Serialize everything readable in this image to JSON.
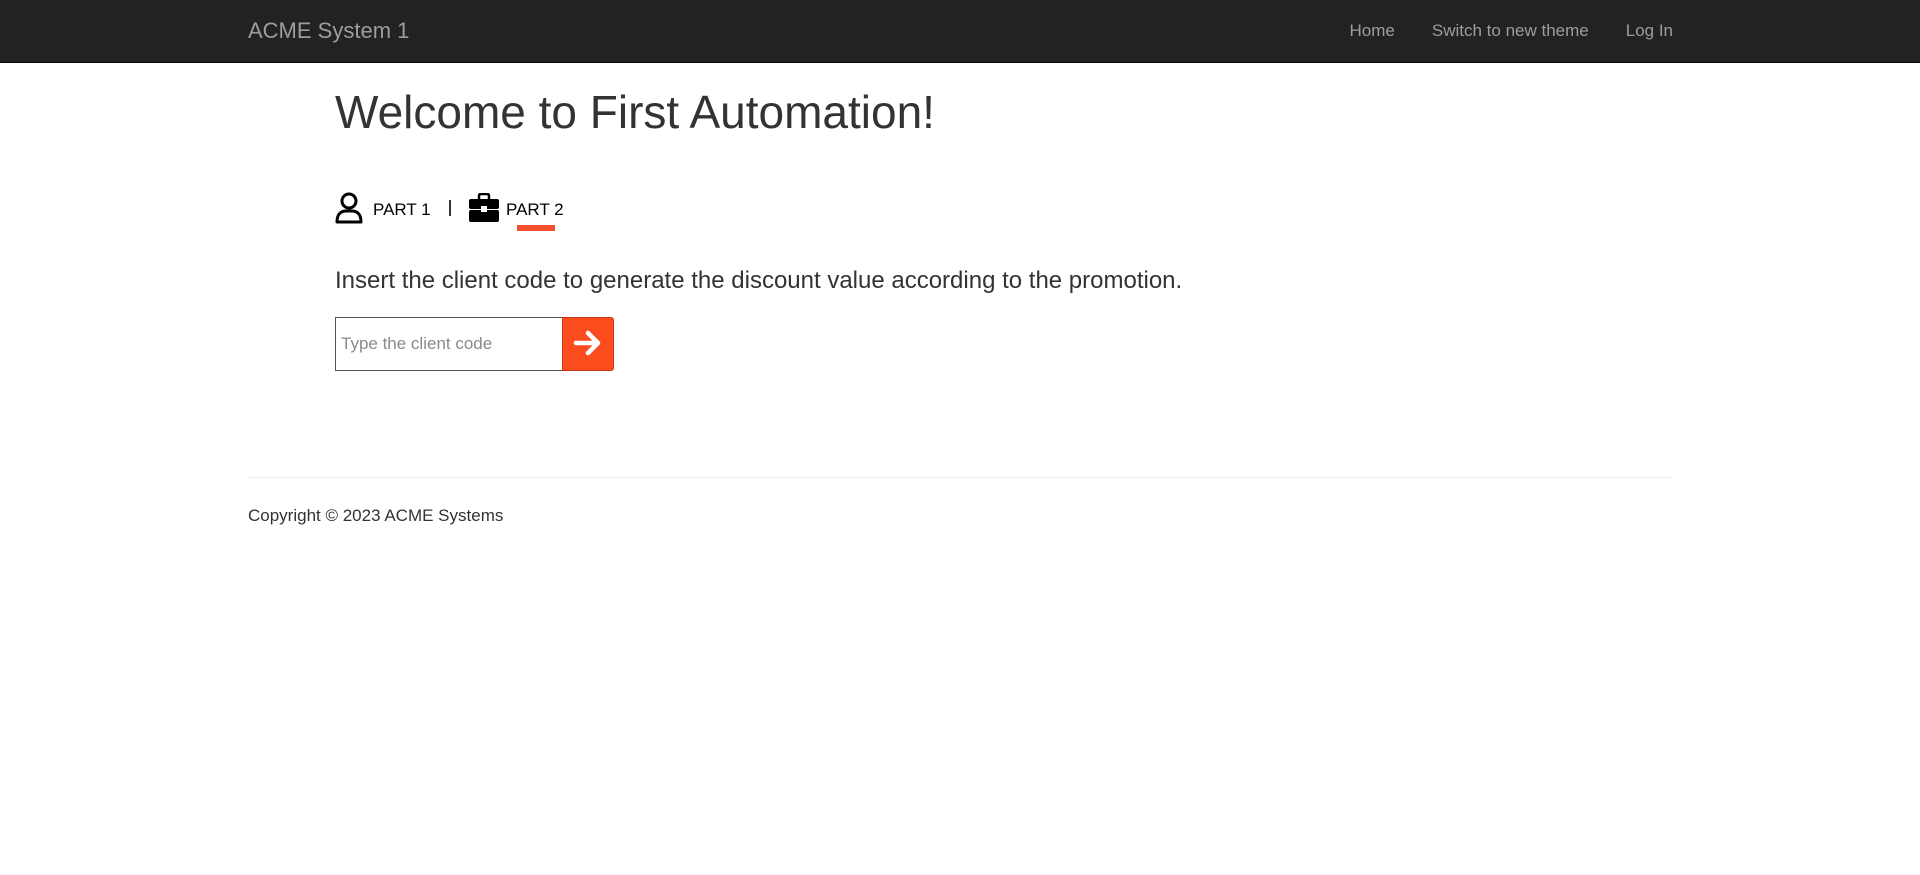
{
  "navbar": {
    "brand": "ACME System 1",
    "links": [
      "Home",
      "Switch to new theme",
      "Log In"
    ]
  },
  "main": {
    "title": "Welcome to First Automation!",
    "tabs": [
      {
        "label": "PART 1",
        "icon": "user-icon"
      },
      {
        "label": "PART 2",
        "icon": "briefcase-icon",
        "active": true
      }
    ],
    "instruction": "Insert the client code to generate the discount value according to the promotion.",
    "client_code": {
      "value": "",
      "placeholder": "Type the client code"
    },
    "submit_icon": "arrow-right-icon"
  },
  "footer": {
    "copyright": "Copyright © 2023 ACME Systems"
  },
  "colors": {
    "navbar_bg": "#222222",
    "accent": "#fc4c1e",
    "text": "#333333"
  }
}
